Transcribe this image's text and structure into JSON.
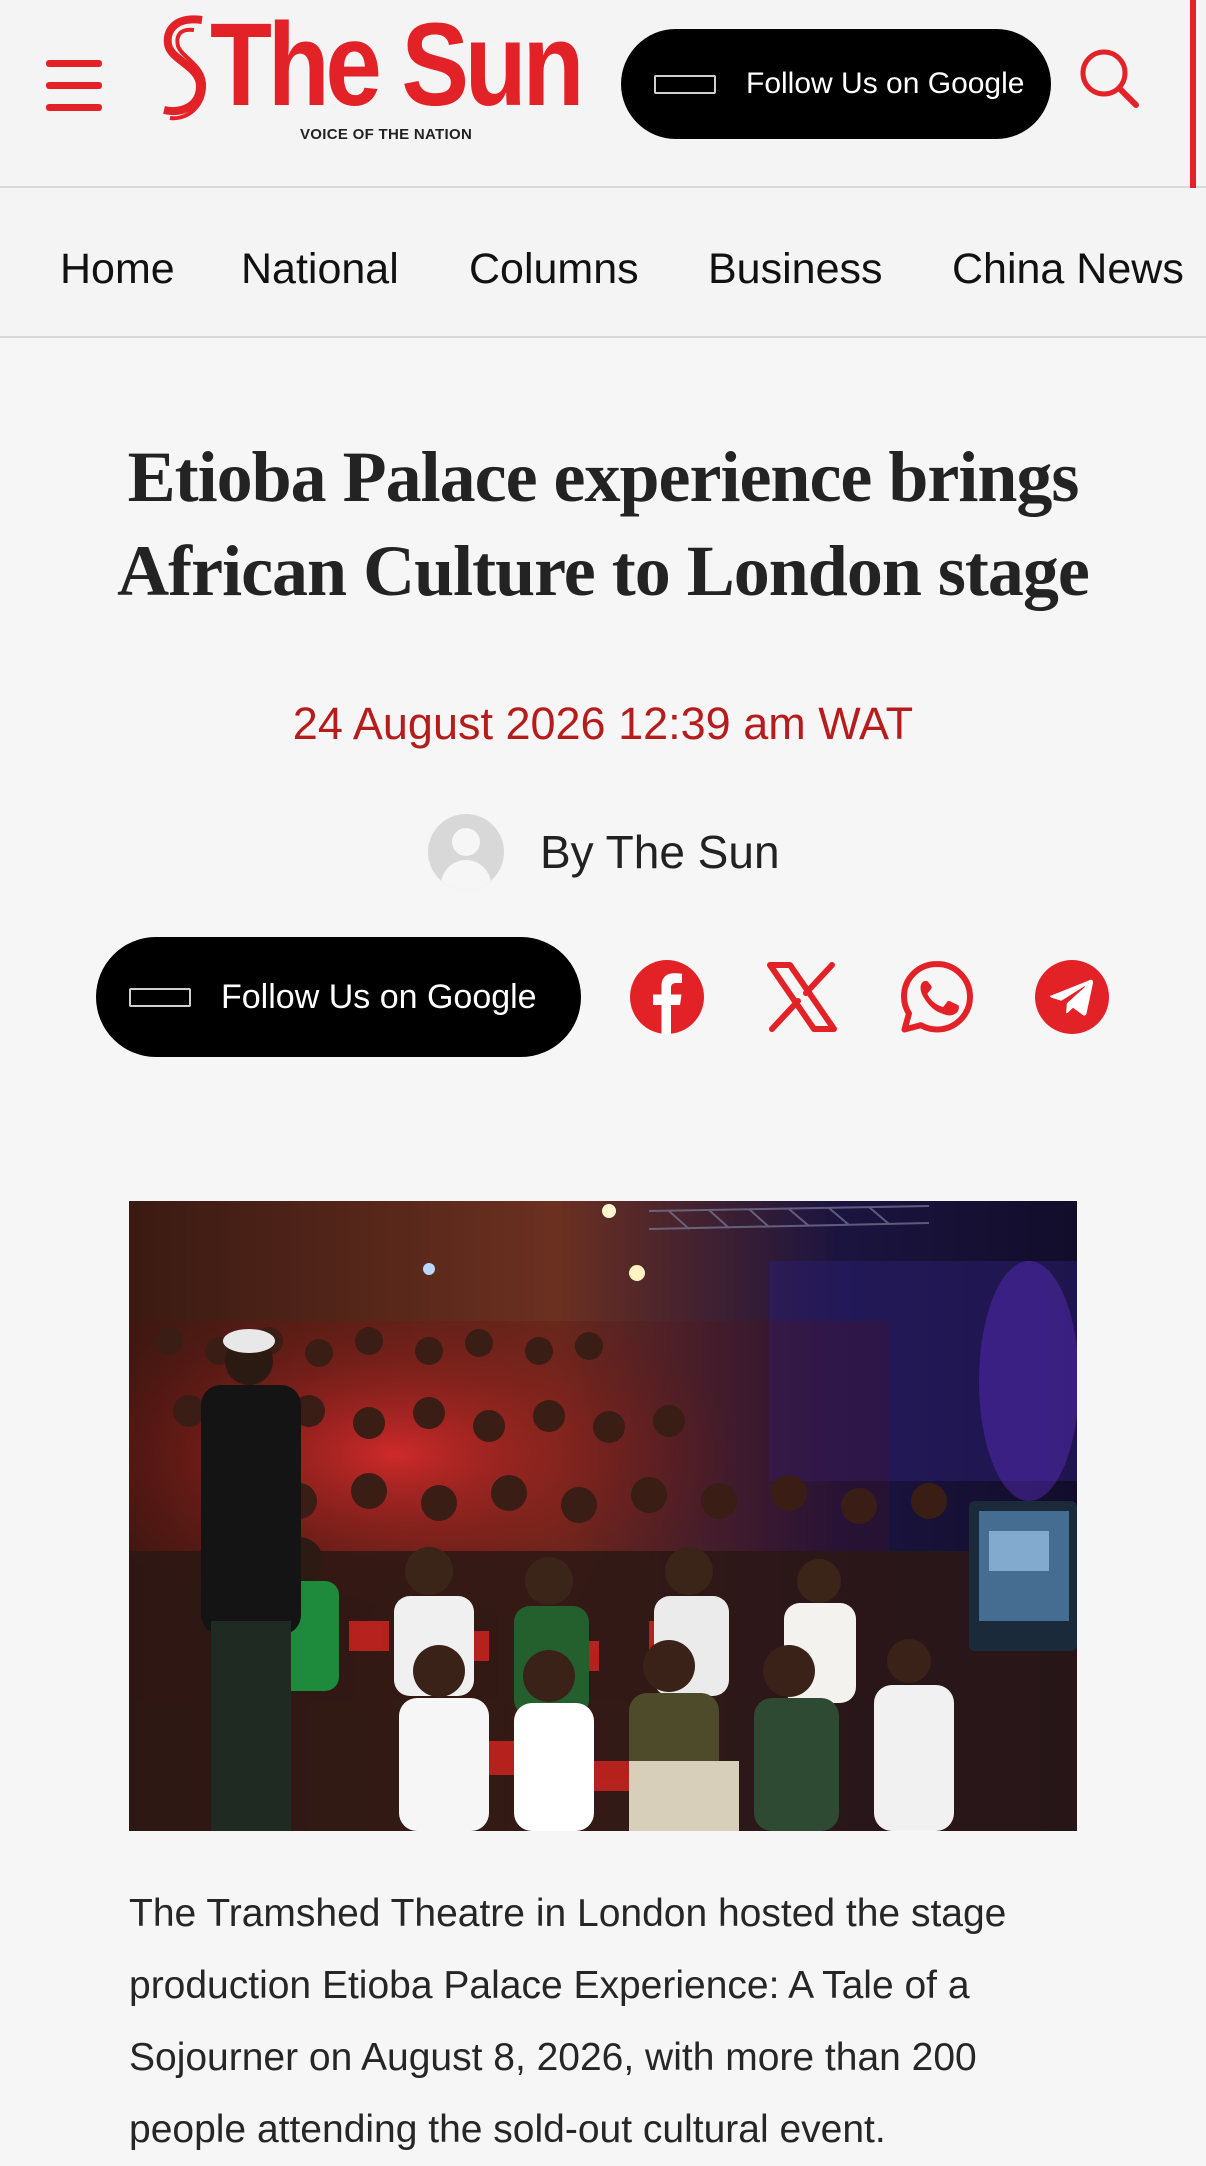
{
  "brand": {
    "name": "The Sun",
    "tagline": "VOICE OF THE NATION",
    "color": "#e32227"
  },
  "header": {
    "follow_label": "Follow Us on Google"
  },
  "nav": {
    "items": [
      {
        "label": "Home"
      },
      {
        "label": "National"
      },
      {
        "label": "Columns"
      },
      {
        "label": "Business"
      },
      {
        "label": "China News"
      }
    ]
  },
  "article": {
    "title": "Etioba Palace experience brings African Culture to London stage",
    "date": "24 August 2026 12:39 am WAT",
    "byline": "By The Sun",
    "follow_label": "Follow Us on Google",
    "share_icons": [
      "facebook-icon",
      "x-icon",
      "whatsapp-icon",
      "telegram-icon"
    ],
    "body": "The Tramshed Theatre in London hosted the stage production Etioba Palace Experience: A Tale of a Sojourner on August 8, 2026, with more than 200 people attending the sold-out cultural event."
  },
  "colors": {
    "accent": "#e32227",
    "date": "#b71c1c",
    "background": "#f6f6f7"
  }
}
